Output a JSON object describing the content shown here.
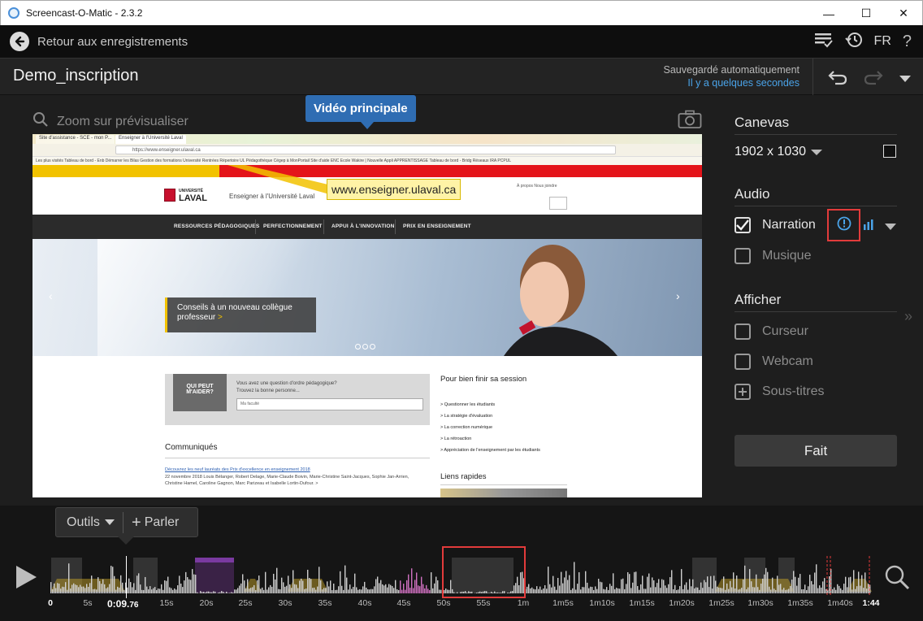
{
  "window": {
    "title": "Screencast-O-Matic - 2.3.2",
    "minimize": "—",
    "maximize": "☐",
    "close": "✕"
  },
  "nav": {
    "back_label": "Retour aux enregistrements",
    "lang": "FR",
    "help": "?"
  },
  "project": {
    "name": "Demo_inscription",
    "autosave_line1": "Sauvegardé automatiquement",
    "autosave_line2": "Il y a quelques secondes"
  },
  "preview": {
    "zoom_placeholder": "Zoom sur prévisualiser",
    "main_video_callout": "Vidéo principale",
    "url_callout": "www.enseigner.ulaval.ca",
    "browser": {
      "tabs": [
        "Site d'assistance - SCE - mon P...",
        "Enseigner à l'Université Laval"
      ],
      "address": "https://www.enseigner.ulaval.ca",
      "bookmarks": "Les plus visités  Tableau de bord - Enb  Démarrer les Bilas  Gestion des formations  Université Rentrées  Répertoire UL  Pédagothèque  Cégep à  MonPortail  Site d'aide ENC  Ecole Wakire | Nouvelle  Appli APPRENTISSAGE  Tableau de bord - Bridg  Réseaux  IRA  PCPUL"
    },
    "site": {
      "logo_line1": "UNIVERSITÉ",
      "logo_line2": "LAVAL",
      "tagline": "Enseigner à l'Université Laval",
      "top_links": "À propos    Nous joindre",
      "nav": [
        "RESSOURCES PÉDAGOGIQUES",
        "PERFECTIONNEMENT",
        "APPUI À L'INNOVATION",
        "PRIX EN ENSEIGNEMENT"
      ],
      "hero_line1": "Conseils à un nouveau collègue",
      "hero_line2": "professeur",
      "help_badge_l1": "QUI PEUT",
      "help_badge_l2": "M'AIDER?",
      "help_q1": "Vous avez une question d'ordre pédagogique?",
      "help_q2": "Trouvez la bonne personne...",
      "help_select": "Ma faculté",
      "communiques_title": "Communiqués",
      "communique_link": "Découvrez les neuf lauréats des Prix d'excellence en enseignement 2018",
      "communique_text": "22 novembre 2018   Louis Bélanger, Robert Delage, Marie-Claude Boivin, Marie-Christine Saint-Jacques, Sophie Jan-Arrien, Christine Hamel, Caroline Gagnon, Marc Parizeau et Isabelle Lortin-Dufour. >",
      "side_title": "Pour bien finir sa session",
      "side_items": [
        "> Questionner les étudiants",
        "> La stratégie d'évaluation",
        "> La correction numérique",
        "> La rétroaction",
        "> Appréciation de l'enseignement par les étudiants"
      ],
      "side_title2": "Liens rapides"
    }
  },
  "right_panel": {
    "canvas_head": "Canevas",
    "resolution": "1902 x 1030",
    "audio_head": "Audio",
    "narration": "Narration",
    "music": "Musique",
    "show_head": "Afficher",
    "cursor": "Curseur",
    "webcam": "Webcam",
    "subtitles": "Sous-titres",
    "done": "Fait"
  },
  "timeline": {
    "tools": "Outils",
    "speak": "Parler",
    "current_time_main": "0:09.",
    "current_time_frac": "76",
    "ticks": [
      {
        "label": "0",
        "bold": true
      },
      {
        "label": "5s"
      },
      {
        "label": "15s"
      },
      {
        "label": "20s"
      },
      {
        "label": "25s"
      },
      {
        "label": "30s"
      },
      {
        "label": "35s"
      },
      {
        "label": "40s"
      },
      {
        "label": "45s"
      },
      {
        "label": "50s"
      },
      {
        "label": "55s"
      },
      {
        "label": "1m"
      },
      {
        "label": "1m5s"
      },
      {
        "label": "1m10s"
      },
      {
        "label": "1m15s"
      },
      {
        "label": "1m20s"
      },
      {
        "label": "1m25s"
      },
      {
        "label": "1m30s"
      },
      {
        "label": "1m35s"
      },
      {
        "label": "1m40s"
      },
      {
        "label": "1:44",
        "bold": true
      }
    ]
  },
  "colors": {
    "accent_blue": "#2f6db3",
    "autosave_blue": "#4aa3e8",
    "highlight_red": "#e23b3b",
    "callout_yellow": "#fff3a6",
    "ul_red": "#e4141a",
    "ul_yellow": "#f2c200"
  }
}
